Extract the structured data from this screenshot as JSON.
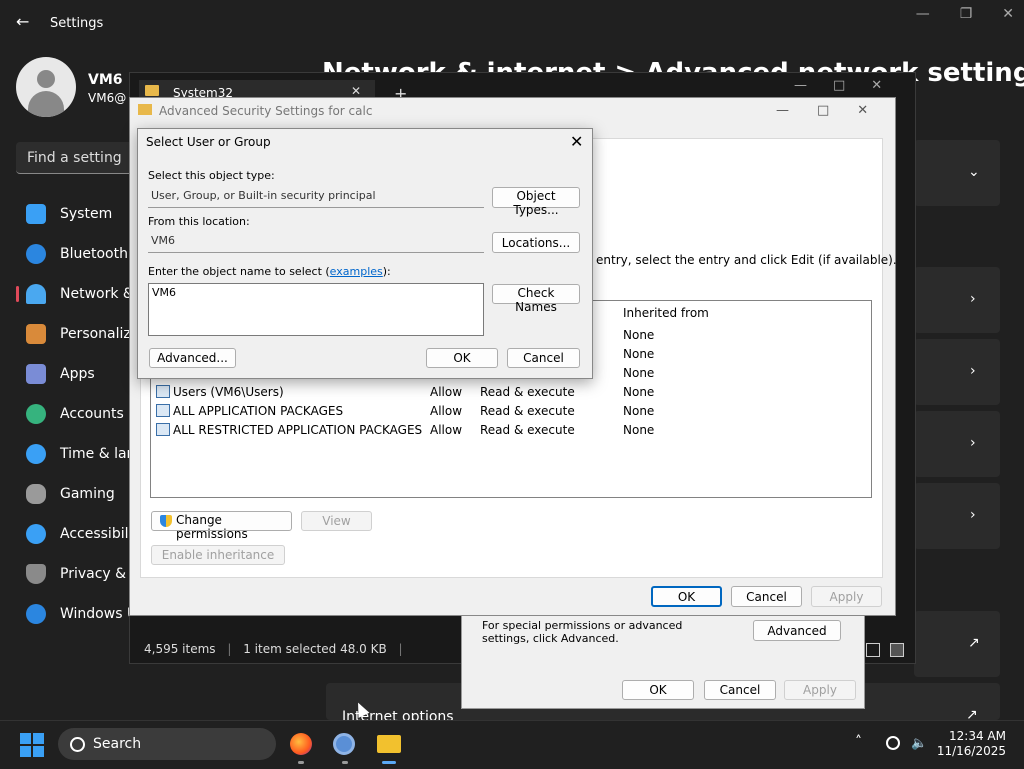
{
  "settings": {
    "title": "Settings",
    "user_name": "VM6",
    "user_email": "VM6@",
    "search_placeholder": "Find a setting",
    "page_title": "Network & internet  >  Advanced network settings",
    "nav": [
      {
        "label": "System",
        "color": "#3aa0f5"
      },
      {
        "label": "Bluetooth & devices",
        "color": "#2b86e0"
      },
      {
        "label": "Network & internet",
        "color": "#4aa8f0"
      },
      {
        "label": "Personalization",
        "color": "#d98a3a"
      },
      {
        "label": "Apps",
        "color": "#7a8cd6"
      },
      {
        "label": "Accounts",
        "color": "#36b37e"
      },
      {
        "label": "Time & language",
        "color": "#3aa0f5"
      },
      {
        "label": "Gaming",
        "color": "#9a9a9a"
      },
      {
        "label": "Accessibility",
        "color": "#3aa0f5"
      },
      {
        "label": "Privacy & security",
        "color": "#8a8a8a"
      },
      {
        "label": "Windows Update",
        "color": "#2b86e0"
      }
    ],
    "internet_options": "Internet options"
  },
  "explorer": {
    "tab_label": "System32",
    "status": {
      "items": "4,595 items",
      "selected": "1 item selected  48.0 KB"
    }
  },
  "properties": {
    "note": "For special permissions or advanced settings, click Advanced.",
    "advanced_btn": "Advanced",
    "ok": "OK",
    "cancel": "Cancel",
    "apply": "Apply"
  },
  "advanced_security": {
    "title": "Advanced Security Settings for calc",
    "instruction": "entry, select the entry and click Edit (if available).",
    "col_inherited": "Inherited from",
    "rows": [
      {
        "principal": "",
        "type": "",
        "access": "",
        "inherited": "None"
      },
      {
        "principal": "",
        "type": "",
        "access": "",
        "inherited": "None"
      },
      {
        "principal": "",
        "type": "",
        "access": "",
        "inherited": "None"
      },
      {
        "principal": "Users (VM6\\Users)",
        "type": "Allow",
        "access": "Read & execute",
        "inherited": "None"
      },
      {
        "principal": "ALL APPLICATION PACKAGES",
        "type": "Allow",
        "access": "Read & execute",
        "inherited": "None"
      },
      {
        "principal": "ALL RESTRICTED APPLICATION PACKAGES",
        "type": "Allow",
        "access": "Read & execute",
        "inherited": "None"
      }
    ],
    "change_permissions": "Change permissions",
    "view": "View",
    "enable_inheritance": "Enable inheritance",
    "ok": "OK",
    "cancel": "Cancel",
    "apply": "Apply"
  },
  "select_user": {
    "title": "Select User or Group",
    "object_type_label": "Select this object type:",
    "object_type_value": "User, Group, or Built-in security principal",
    "object_types_btn": "Object Types...",
    "location_label": "From this location:",
    "location_value": "VM6",
    "locations_btn": "Locations...",
    "name_label_pre": "Enter the object name to select (",
    "name_label_link": "examples",
    "name_label_post": "):",
    "name_value": "VM6",
    "check_names_btn": "Check Names",
    "advanced_btn": "Advanced...",
    "ok": "OK",
    "cancel": "Cancel"
  },
  "taskbar": {
    "search": "Search",
    "time": "12:34 AM",
    "date": "11/16/2025"
  }
}
